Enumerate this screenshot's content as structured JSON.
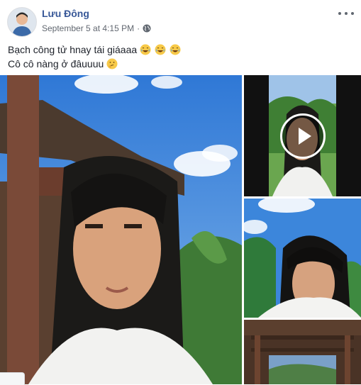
{
  "post": {
    "author": "Lưu Đông",
    "timestamp": "September 5 at 4:15 PM",
    "separator": "·",
    "privacy_icon": "globe-icon",
    "more_icon": "more-options-icon",
    "text_lines": [
      "Bạch công tử hnay tái giáaaa",
      "Cô cô nàng ở đâuuuu"
    ],
    "emojis": {
      "line1": [
        "laughing-tears-emoji",
        "laughing-tears-emoji",
        "laughing-tears-emoji"
      ],
      "line2": [
        "thinking-face-emoji"
      ]
    }
  },
  "media": {
    "main_photo": "selfie-photo-with-sky",
    "video": {
      "play_icon": "play-icon"
    },
    "photo_b": "selfie-photo-blue-sky",
    "photo_c": "wooden-pavilion-photo"
  },
  "colors": {
    "author_link": "#385898",
    "meta_text": "#616770",
    "body_text": "#1d2129",
    "sky": "#4a88d8"
  }
}
